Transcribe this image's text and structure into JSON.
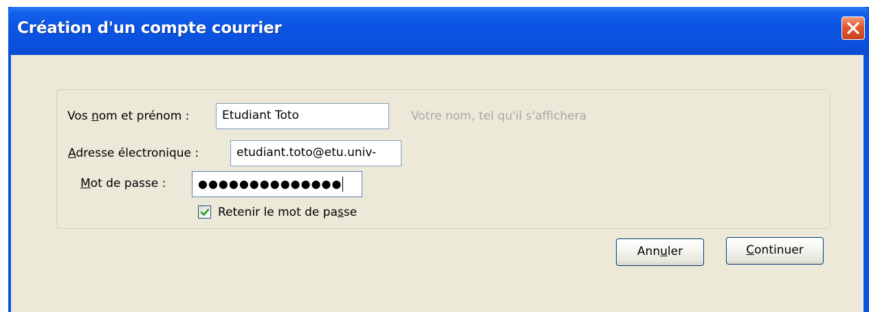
{
  "dialog": {
    "title": "Création d'un compte courrier",
    "close_icon": "close-icon"
  },
  "form": {
    "name": {
      "label_pre": "Vos ",
      "label_key": "n",
      "label_post": "om et prénom :",
      "value": "Etudiant Toto",
      "hint": "Votre nom, tel qu'il s'affichera"
    },
    "email": {
      "label_key": "A",
      "label_post": "dresse électronique :",
      "value": "etudiant.toto@etu.univ-"
    },
    "password": {
      "label_key": "M",
      "label_post": "ot de passe :",
      "value_masked": "●●●●●●●●●●●●●●"
    },
    "remember": {
      "label_pre": "Retenir le mot de pa",
      "label_key": "s",
      "label_post": "se",
      "checked": true
    }
  },
  "buttons": {
    "cancel": {
      "pre": "Ann",
      "key": "u",
      "post": "ler"
    },
    "continue": {
      "key": "C",
      "post": "ontinuer"
    }
  },
  "colors": {
    "titlebar": "#0a55e0",
    "client_bg": "#ece9d8",
    "check_mark": "#21a121",
    "close_button": "#e1582f"
  }
}
